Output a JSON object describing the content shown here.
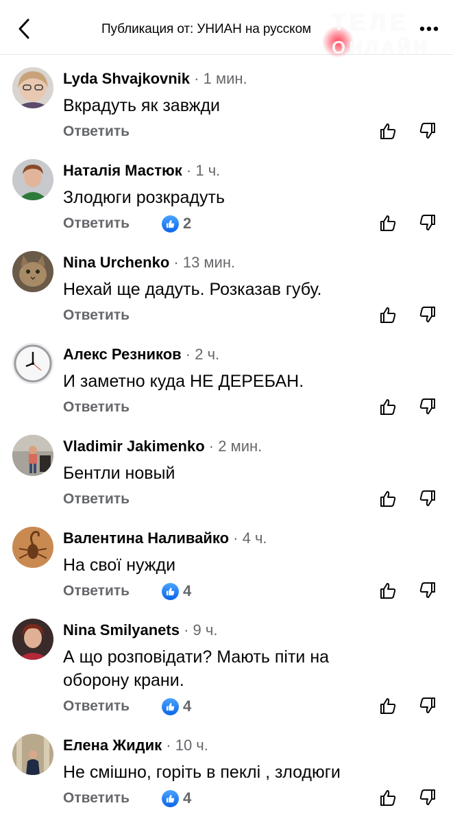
{
  "header": {
    "title": "Публикация от: УНИАН на русском"
  },
  "watermark": {
    "line1": "ТЕЛЕ",
    "line2": "ОНЛАЙН"
  },
  "reply_label": "Ответить",
  "comments": [
    {
      "name": "Lyda Shvajkovnik",
      "time": "1 мин.",
      "text": "Вкрадуть як завжди",
      "likes": ""
    },
    {
      "name": "Наталія Мастюк",
      "time": "1 ч.",
      "text": "Злодюги розкрадуть",
      "likes": "2"
    },
    {
      "name": "Nina Urchenko",
      "time": "13 мин.",
      "text": "Нехай ще дадуть. Розказав губу.",
      "likes": ""
    },
    {
      "name": "Алекс Резников",
      "time": "2 ч.",
      "text": "И заметно куда НЕ ДЕРЕБАН.",
      "likes": ""
    },
    {
      "name": "Vladimir Jakimenko",
      "time": "2 мин.",
      "text": "Бентли новый",
      "likes": ""
    },
    {
      "name": "Валентина Наливайко",
      "time": "4 ч.",
      "text": "На свої нужди",
      "likes": "4"
    },
    {
      "name": "Nina Smilyanets",
      "time": "9 ч.",
      "text": "А що розповідати? Мають піти на оборону крани.",
      "likes": "4"
    },
    {
      "name": "Елена Жидик",
      "time": "10 ч.",
      "text": "Не смішно, горіть в пеклі , злодюги",
      "likes": "4"
    }
  ],
  "colors": {
    "like_blue": "#1877f2",
    "secondary_text": "#65676b",
    "primary_text": "#050505"
  }
}
